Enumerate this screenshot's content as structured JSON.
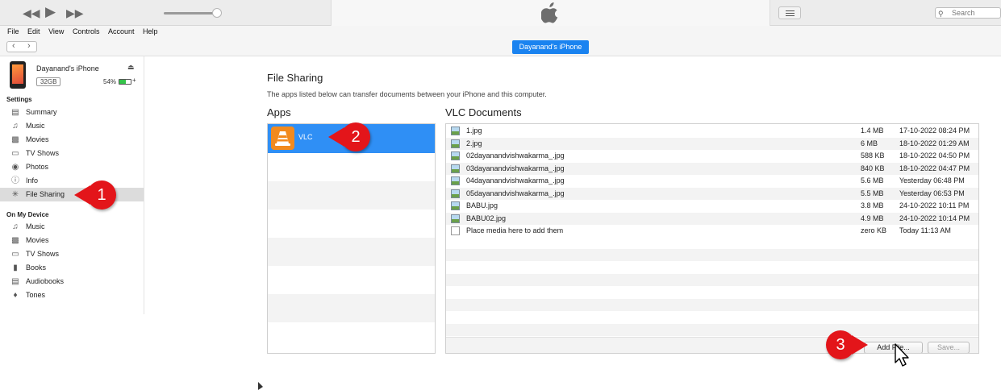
{
  "menu": [
    "File",
    "Edit",
    "View",
    "Controls",
    "Account",
    "Help"
  ],
  "search": {
    "placeholder": "Search"
  },
  "navbar": {
    "device_button": "Dayanand's iPhone"
  },
  "device": {
    "name": "Dayanand's iPhone",
    "capacity": "32GB",
    "battery_pct": "54%",
    "battery_level": 0.54,
    "charging": "+"
  },
  "sidebar": {
    "settings_header": "Settings",
    "settings_items": [
      {
        "label": "Summary",
        "icon": "summary-icon"
      },
      {
        "label": "Music",
        "icon": "music-note-icon"
      },
      {
        "label": "Movies",
        "icon": "film-icon"
      },
      {
        "label": "TV Shows",
        "icon": "tv-icon"
      },
      {
        "label": "Photos",
        "icon": "camera-icon"
      },
      {
        "label": "Info",
        "icon": "info-icon"
      },
      {
        "label": "File Sharing",
        "icon": "apps-icon",
        "selected": true
      }
    ],
    "device_header": "On My Device",
    "device_items": [
      {
        "label": "Music",
        "icon": "music-note-icon"
      },
      {
        "label": "Movies",
        "icon": "film-icon"
      },
      {
        "label": "TV Shows",
        "icon": "tv-icon"
      },
      {
        "label": "Books",
        "icon": "book-icon"
      },
      {
        "label": "Audiobooks",
        "icon": "audiobook-icon"
      },
      {
        "label": "Tones",
        "icon": "bell-icon"
      }
    ]
  },
  "main": {
    "title": "File Sharing",
    "description": "The apps listed below can transfer documents between your iPhone and this computer.",
    "apps_header": "Apps",
    "apps": [
      {
        "label": "VLC",
        "selected": true
      }
    ],
    "docs_header": "VLC Documents",
    "documents": [
      {
        "name": "1.jpg",
        "size": "1.4 MB",
        "date": "17-10-2022 08:24 PM"
      },
      {
        "name": "2.jpg",
        "size": "6 MB",
        "date": "18-10-2022 01:29 AM"
      },
      {
        "name": "02dayanandvishwakarma_.jpg",
        "size": "588 KB",
        "date": "18-10-2022 04:50 PM"
      },
      {
        "name": "03dayanandvishwakarma_.jpg",
        "size": "840 KB",
        "date": "18-10-2022 04:47 PM"
      },
      {
        "name": "04dayanandvishwakarma_.jpg",
        "size": "5.6 MB",
        "date": "Yesterday 06:48 PM"
      },
      {
        "name": "05dayanandvishwakarma_.jpg",
        "size": "5.5 MB",
        "date": "Yesterday 06:53 PM"
      },
      {
        "name": "BABU.jpg",
        "size": "3.8 MB",
        "date": "24-10-2022 10:11 PM"
      },
      {
        "name": "BABU02.jpg",
        "size": "4.9 MB",
        "date": "24-10-2022 10:14 PM"
      },
      {
        "name": "Place media here to add them",
        "size": "zero KB",
        "date": "Today 11:13 AM",
        "blank": true
      }
    ],
    "add_file_label": "Add File...",
    "save_label": "Save..."
  },
  "annotations": [
    "1",
    "2",
    "3"
  ],
  "colors": {
    "accent": "#1a83f0",
    "selection": "#2f8ff5",
    "callout": "#e3151a",
    "vlc": "#f28a1e",
    "sidebar_selected": "#dcdcdc"
  }
}
